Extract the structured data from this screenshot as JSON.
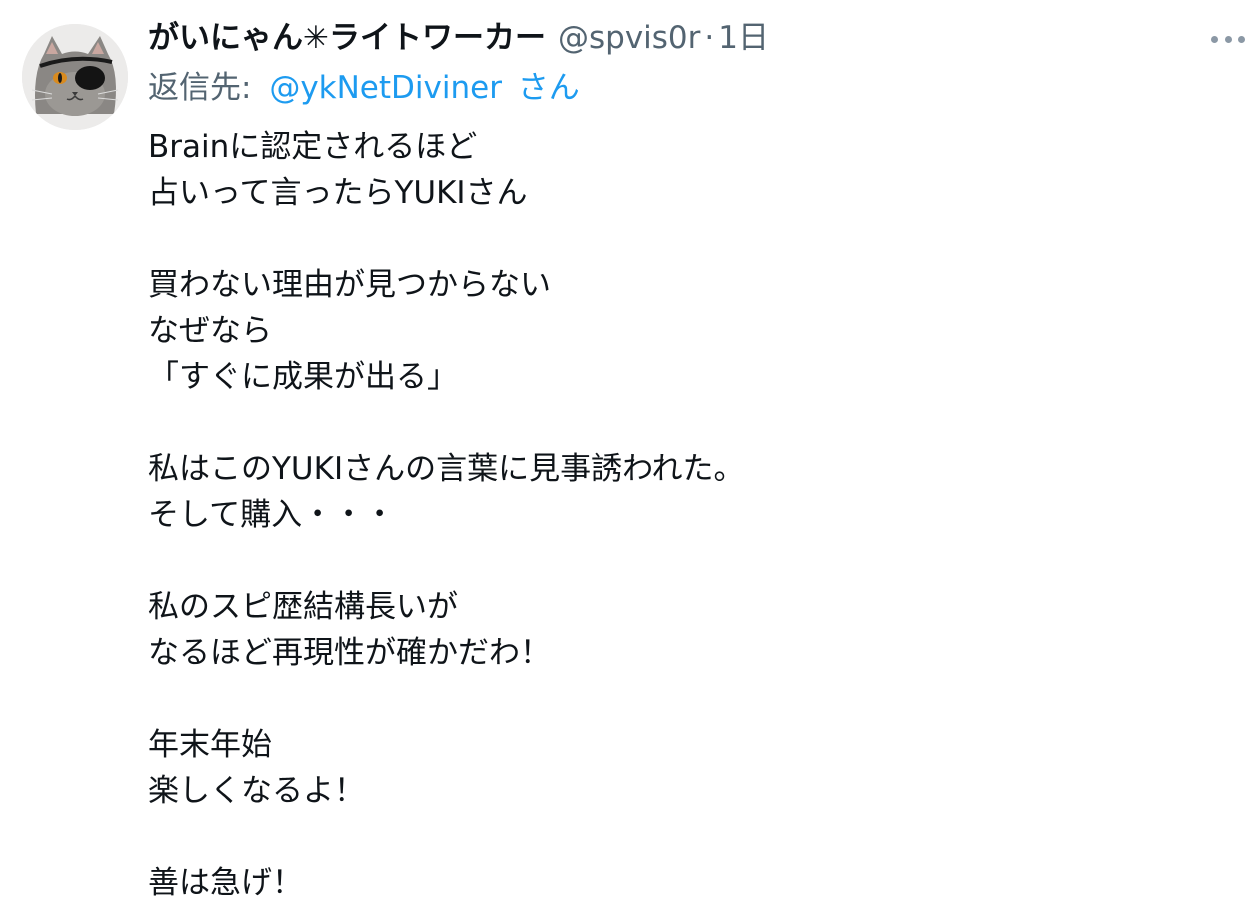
{
  "tweet": {
    "display_name": "がいにゃん✳︎ライトワーカー",
    "handle": "@spvis0r",
    "separator": "·",
    "time": "1日",
    "more_icon": "more-dots-icon",
    "reply_to": {
      "label": "返信先:",
      "mention": "@ykNetDiviner",
      "suffix": "さん"
    },
    "lines": [
      "Brainに認定されるほど",
      "占いって言ったらYUKIさん",
      "",
      "買わない理由が見つからない",
      "なぜなら",
      "「すぐに成果が出る」",
      "",
      "私はこのYUKIさんの言葉に見事誘われた。",
      "そして購入・・・",
      "",
      "私のスピ歴結構長いが",
      "なるほど再現性が確かだわ！",
      "",
      "年末年始",
      "楽しくなるよ！",
      "",
      "善は急げ！"
    ]
  },
  "colors": {
    "text": "#0f1419",
    "secondary": "#536471",
    "link": "#1d9bf0"
  }
}
